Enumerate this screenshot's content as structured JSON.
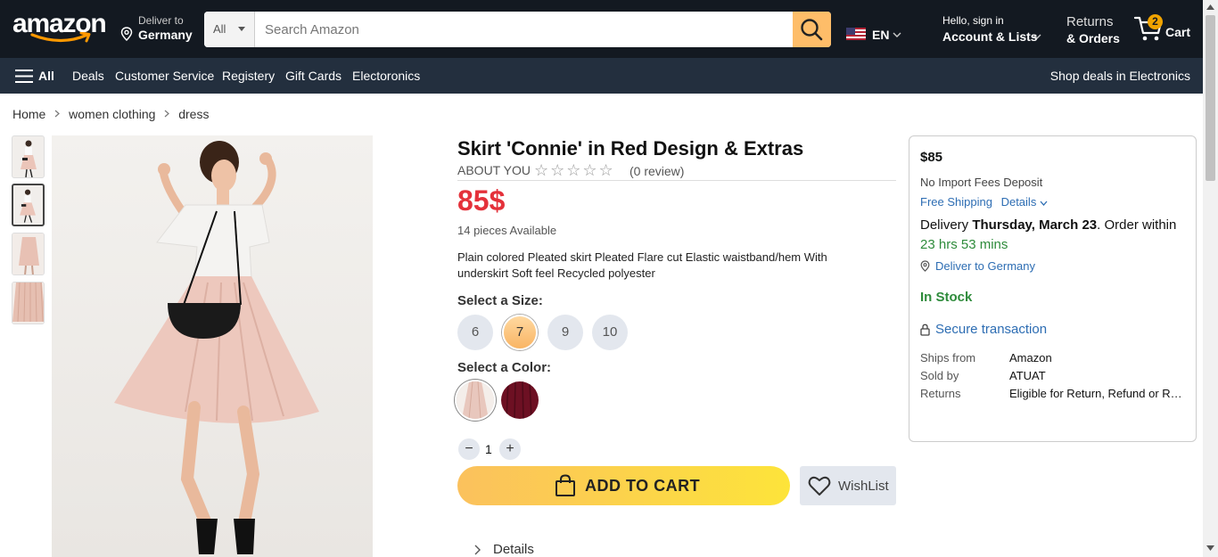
{
  "header": {
    "logo_text": "amazon",
    "deliver_to_label": "Deliver to",
    "deliver_to_country": "Germany",
    "search_category": "All",
    "search_placeholder": "Search Amazon",
    "language": "EN",
    "account_greeting": "Hello, sign in",
    "account_label": "Account & Lists",
    "returns_label": "Returns",
    "orders_label": "& Orders",
    "cart_count": "2",
    "cart_label": "Cart"
  },
  "nav": {
    "all_label": "All",
    "items": [
      "Deals",
      "Customer Service",
      "Registery",
      "Gift Cards",
      "Electoronics"
    ],
    "right_link": "Shop deals in Electronics"
  },
  "breadcrumb": [
    "Home",
    "women clothing",
    "dress"
  ],
  "product": {
    "title": "Skirt 'Connie' in Red Design & Extras",
    "brand": "ABOUT YOU",
    "stars": "☆☆☆☆☆",
    "reviews": "(0 review)",
    "price": "85$",
    "availability": "14 pieces Available",
    "description": "Plain colored Pleated skirt Pleated Flare cut Elastic waistband/hem With underskirt Soft feel Recycled polyester",
    "size_label": "Select a Size:",
    "sizes": [
      "6",
      "7",
      "9",
      "10"
    ],
    "selected_size": "7",
    "color_label": "Select a Color:",
    "colors": [
      {
        "name": "pink",
        "hex": "#e8c7bd"
      },
      {
        "name": "burgundy",
        "hex": "#6d1023"
      }
    ],
    "quantity": "1",
    "qty_minus": "−",
    "qty_plus": "+",
    "add_to_cart": "ADD TO CART",
    "wishlist": "WishList",
    "details": "Details"
  },
  "buybox": {
    "price": "$85",
    "fees": "No Import Fees Deposit",
    "shipping": "Free Shipping",
    "details_link": "Details",
    "delivery_prefix": "Delivery ",
    "delivery_date": "Thursday, March 23",
    "delivery_suffix": ". Order within",
    "timer": "23 hrs 53 mins",
    "deliver_to": "Deliver to Germany",
    "stock": "In Stock",
    "secure": "Secure transaction",
    "rows": [
      {
        "key": "Ships from",
        "value": "Amazon"
      },
      {
        "key": "Sold by",
        "value": "ATUAT"
      },
      {
        "key": "Returns",
        "value": "Eligible for Return, Refund or Replacement"
      }
    ]
  },
  "colors": {
    "header_bg": "#131921",
    "nav_bg": "#232f3e",
    "search_button": "#febd69",
    "price_red": "#e4313a",
    "link_blue": "#2d6db3",
    "stock_green": "#2e8b3b"
  }
}
